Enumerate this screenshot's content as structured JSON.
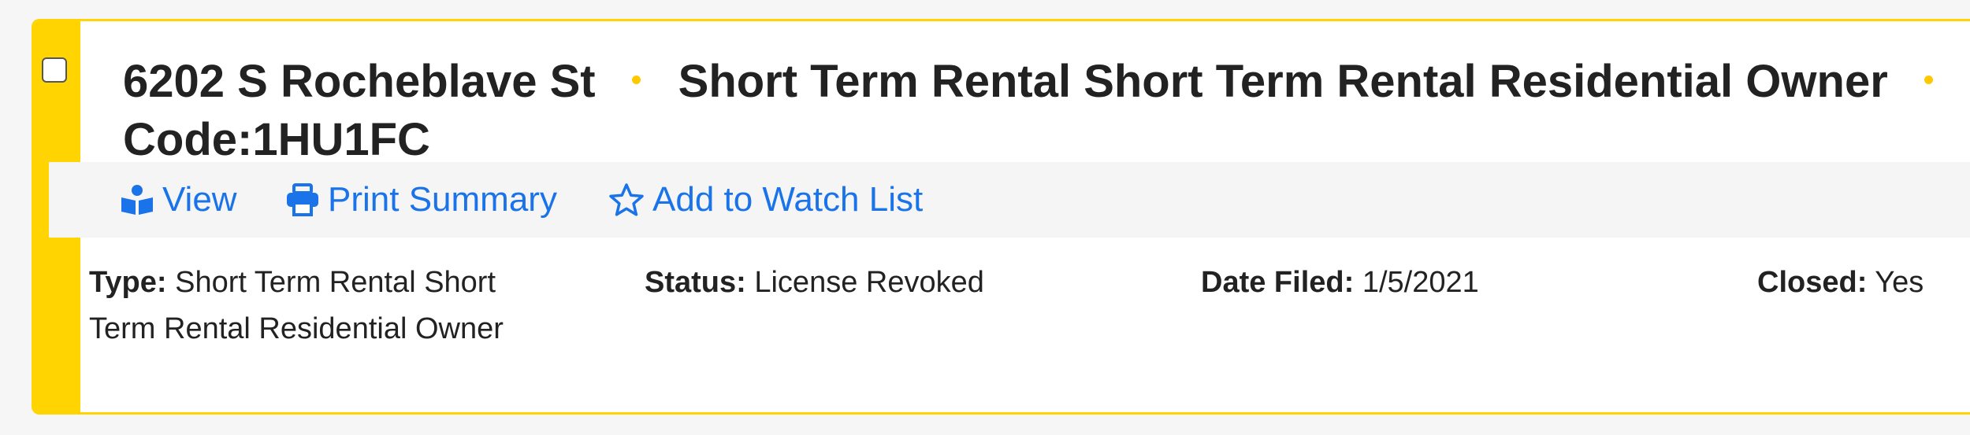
{
  "record": {
    "address": "6202 S Rocheblave St",
    "type_title": "Short Term Rental Short Term Rental Residential Owner",
    "code": "Code:1HU1FC"
  },
  "actions": {
    "view_label": "View",
    "print_label": "Print Summary",
    "watch_label": "Add to Watch List"
  },
  "fields": {
    "type_label": "Type:",
    "type_value": "Short Term Rental Short Term Rental Residential Owner",
    "status_label": "Status:",
    "status_value": "License Revoked",
    "date_label": "Date Filed:",
    "date_value": "1/5/2021",
    "closed_label": "Closed:",
    "closed_value": "Yes"
  },
  "icons": {
    "view": "book-reader-icon",
    "print": "printer-icon",
    "watch": "star-outline-icon"
  },
  "colors": {
    "accent": "#ffd400",
    "link": "#1a73e8"
  }
}
